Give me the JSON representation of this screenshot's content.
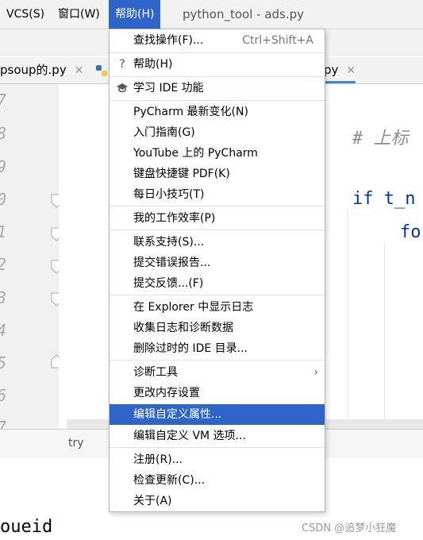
{
  "menubar": {
    "items": [
      {
        "label": "VCS(S)"
      },
      {
        "label": "窗口(W)"
      },
      {
        "label": "帮助(H)"
      }
    ],
    "window_title": "python_tool - ads.py"
  },
  "tabs": [
    {
      "label": "psoup的.py"
    },
    {
      "label": "py"
    }
  ],
  "gutter": {
    "lines": [
      "7",
      "8",
      "9",
      "0",
      "1",
      "2",
      "3",
      "4",
      "5",
      "6",
      "7"
    ]
  },
  "editor": {
    "comment": "# 上标",
    "line_if": "if t_n",
    "line_for": "fo"
  },
  "statusline": {
    "text": "try"
  },
  "bottom_code": "oueid",
  "watermark": "CSDN @追梦小狂魔",
  "help_menu": {
    "find_action": {
      "label": "查找操作(F)...",
      "shortcut": "Ctrl+Shift+A"
    },
    "help": {
      "label": "帮助(H)"
    },
    "learn_ide": {
      "label": "学习 IDE 功能"
    },
    "whats_new": {
      "label": "PyCharm 最新变化(N)"
    },
    "getting_started": {
      "label": "入门指南(G)"
    },
    "youtube": {
      "label": "YouTube 上的 PyCharm"
    },
    "keymap_pdf": {
      "label": "键盘快捷键 PDF(K)"
    },
    "tip_of_day": {
      "label": "每日小技巧(T)"
    },
    "productivity": {
      "label": "我的工作效率(P)"
    },
    "contact_support": {
      "label": "联系支持(S)..."
    },
    "submit_bug": {
      "label": "提交错误报告..."
    },
    "submit_feedback": {
      "label": "提交反馈...(F)"
    },
    "show_log": {
      "label": "在 Explorer 中显示日志"
    },
    "collect_logs": {
      "label": "收集日志和诊断数据"
    },
    "delete_ide_dirs": {
      "label": "删除过时的 IDE 目录..."
    },
    "diagnostic_tools": {
      "label": "诊断工具"
    },
    "change_memory": {
      "label": "更改内存设置"
    },
    "edit_properties": {
      "label": "编辑自定义属性..."
    },
    "edit_vm_options": {
      "label": "编辑自定义 VM 选项..."
    },
    "register": {
      "label": "注册(R)..."
    },
    "check_updates": {
      "label": "检查更新(C)..."
    },
    "about": {
      "label": "关于(A)"
    }
  }
}
